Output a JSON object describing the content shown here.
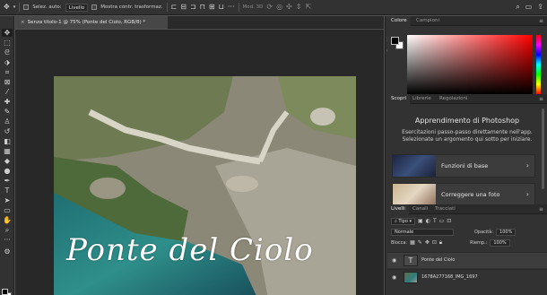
{
  "options_bar": {
    "auto_select_label": "Selez. auto:",
    "auto_select_value": "Livello",
    "transform_label": "Mostra contr. trasformaz.",
    "mode_3d_label": "Mod. 3D"
  },
  "document": {
    "tab_title": "Senza titolo-1 @ 75% (Ponte del Ciolo, RGB/8) *"
  },
  "canvas": {
    "overlay_text": "Ponte del Ciolo"
  },
  "panels": {
    "color_tabs": [
      "Colore",
      "Campioni"
    ],
    "discover_tabs": [
      "Scopri",
      "Librerie",
      "Regolazioni"
    ],
    "discover": {
      "title": "Apprendimento di Photoshop",
      "description": "Esercitazioni passo-passo direttamente nell'app. Selezionate un argomento qui sotto per iniziare.",
      "cards": [
        "Funzioni di base",
        "Correggere una foto"
      ]
    },
    "layers_tabs": [
      "Livelli",
      "Canali",
      "Tracciati"
    ],
    "layers": {
      "filter_label": "Tipo",
      "blend_mode": "Normale",
      "opacity_label": "Opacità:",
      "opacity_value": "100%",
      "lock_label": "Blocca:",
      "fill_label": "Riemp.:",
      "fill_value": "100%",
      "items": [
        {
          "name": "Ponte del Ciolo",
          "type": "text"
        },
        {
          "name": "1678A277168_IMG_1697",
          "type": "image"
        }
      ]
    }
  },
  "colors": {
    "chrome": "#323232",
    "canvas_bg": "#282828",
    "foreground": "#000000",
    "background": "#ffffff"
  }
}
